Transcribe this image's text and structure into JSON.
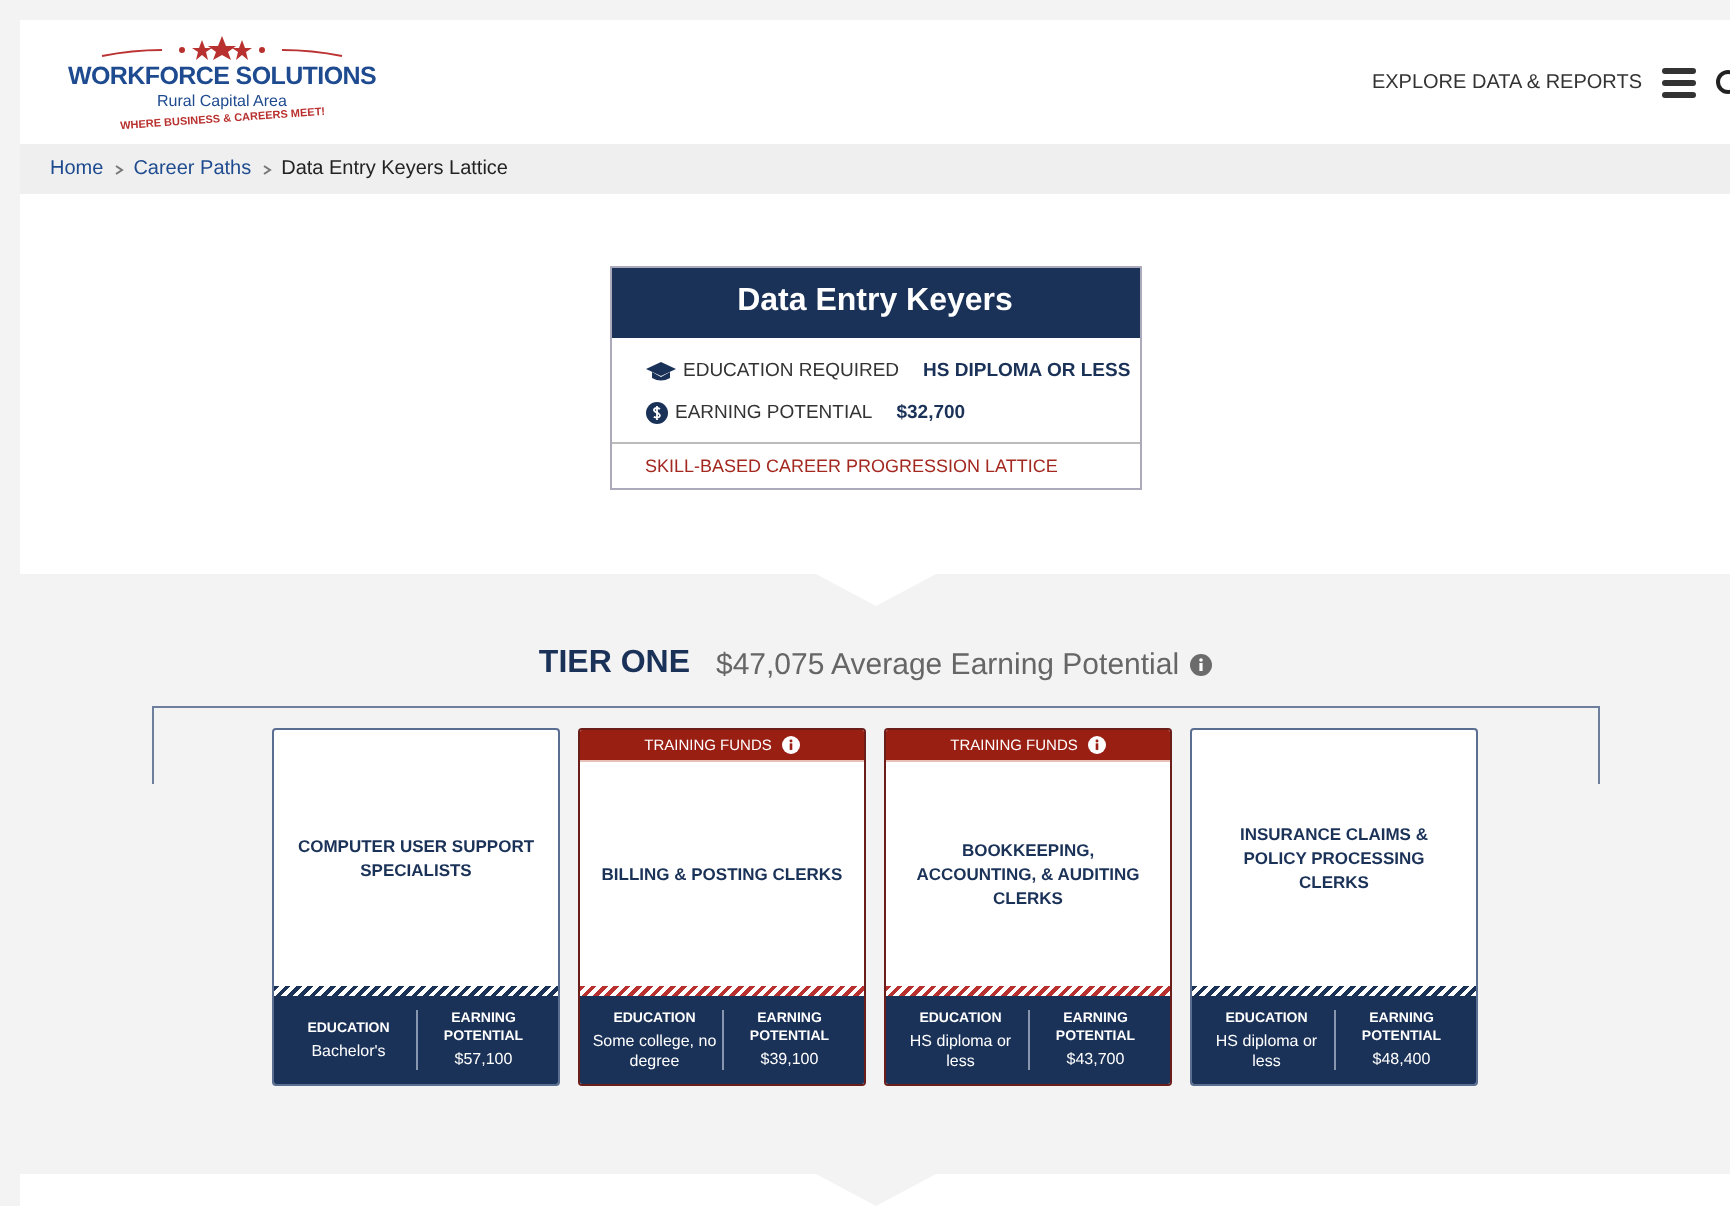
{
  "header": {
    "logo": {
      "title": "WORKFORCE SOLUTIONS",
      "subtitle": "Rural Capital Area",
      "tagline": "WHERE BUSINESS & CAREERS MEET!"
    },
    "nav_link": "EXPLORE DATA & REPORTS"
  },
  "breadcrumb": [
    {
      "label": "Home",
      "link": true
    },
    {
      "label": "Career Paths",
      "link": true
    },
    {
      "label": "Data Entry Keyers Lattice",
      "link": false
    }
  ],
  "occupation": {
    "title": "Data Entry Keyers",
    "education_label": "EDUCATION REQUIRED",
    "education_value": "HS DIPLOMA OR LESS",
    "earning_label": "EARNING POTENTIAL",
    "earning_value": "$32,700",
    "footer": "SKILL-BASED CAREER PROGRESSION LATTICE"
  },
  "tier": {
    "name": "TIER ONE",
    "summary": "$47,075 Average Earning Potential",
    "cards": [
      {
        "title": "COMPUTER USER SUPPORT SPECIALISTS",
        "funded": false,
        "education_label": "EDUCATION",
        "education": "Bachelor's",
        "earning_label": "EARNING POTENTIAL",
        "earning": "$57,100"
      },
      {
        "title": "BILLING & POSTING CLERKS",
        "funded": true,
        "banner": "TRAINING FUNDS",
        "education_label": "EDUCATION",
        "education": "Some college, no degree",
        "earning_label": "EARNING POTENTIAL",
        "earning": "$39,100"
      },
      {
        "title": "BOOKKEEPING, ACCOUNTING, & AUDITING CLERKS",
        "funded": true,
        "banner": "TRAINING FUNDS",
        "education_label": "EDUCATION",
        "education": "HS diploma or less",
        "earning_label": "EARNING POTENTIAL",
        "earning": "$43,700"
      },
      {
        "title": "INSURANCE CLAIMS & POLICY PROCESSING CLERKS",
        "funded": false,
        "education_label": "EDUCATION",
        "education": "HS diploma or less",
        "earning_label": "EARNING POTENTIAL",
        "earning": "$48,400"
      }
    ]
  }
}
